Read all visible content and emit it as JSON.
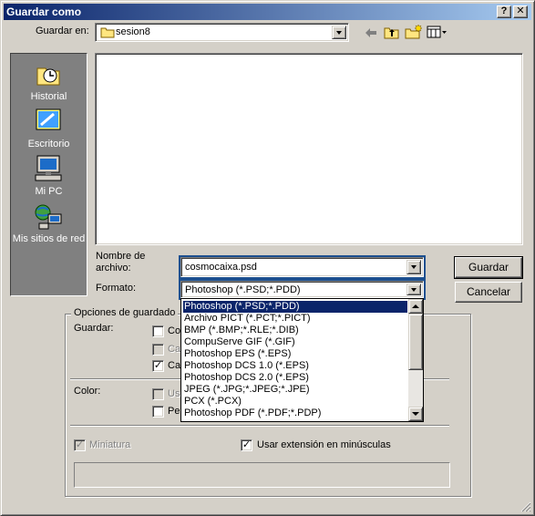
{
  "window": {
    "title": "Guardar como",
    "help_label": "?",
    "close_label": "✕"
  },
  "toolbar": {
    "save_in_label": "Guardar en:",
    "current_folder": "sesion8",
    "icons": [
      "back-arrow-icon",
      "up-folder-icon",
      "new-folder-icon",
      "view-menu-icon"
    ]
  },
  "places": [
    {
      "label": "Historial",
      "icon": "history-icon"
    },
    {
      "label": "Escritorio",
      "icon": "desktop-icon"
    },
    {
      "label": "Mi PC",
      "icon": "my-computer-icon"
    },
    {
      "label": "Mis sitios de red",
      "icon": "network-places-icon"
    }
  ],
  "file": {
    "name_label_line1": "Nombre de",
    "name_label_line2": "archivo:",
    "name_value": "cosmocaixa.psd",
    "format_label": "Formato:",
    "format_value": "Photoshop (*.PSD;*.PDD)"
  },
  "buttons": {
    "save": "Guardar",
    "cancel": "Cancelar"
  },
  "format_options": [
    "Photoshop (*.PSD;*.PDD)",
    "Archivo PICT (*.PCT;*.PICT)",
    "BMP (*.BMP;*.RLE;*.DIB)",
    "CompuServe GIF (*.GIF)",
    "Photoshop EPS (*.EPS)",
    "Photoshop DCS 1.0 (*.EPS)",
    "Photoshop DCS 2.0 (*.EPS)",
    "JPEG (*.JPG;*.JPEG;*.JPE)",
    "PCX (*.PCX)",
    "Photoshop PDF (*.PDF;*.PDP)"
  ],
  "options": {
    "group_label": "Opciones de guardado",
    "save_label": "Guardar:",
    "save_items": [
      {
        "text": "Co",
        "checked": false,
        "enabled": true
      },
      {
        "text": "Ca",
        "checked": false,
        "enabled": false
      },
      {
        "text": "Ca",
        "checked": true,
        "enabled": true
      }
    ],
    "color_label": "Color:",
    "color_items": [
      {
        "text": "Us",
        "checked": false,
        "enabled": false
      },
      {
        "text": "Pe",
        "checked": false,
        "enabled": true
      }
    ],
    "thumbnail": {
      "text": "Miniatura",
      "checked": true,
      "enabled": false
    },
    "lowercase_ext": {
      "text": "Usar extensión en minúsculas",
      "checked": true,
      "enabled": true
    }
  },
  "colors": {
    "title_start": "#0a246a",
    "title_end": "#a6caf0",
    "selection": "#0a246a",
    "face": "#d4d0c8"
  }
}
